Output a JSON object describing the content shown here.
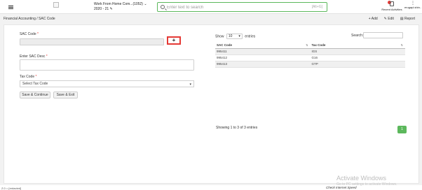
{
  "header": {
    "company_name": "Work From Home Com...(1052)",
    "company_year": "2020 - 21",
    "search_placeholder": "Enter text to search",
    "search_shortcut": "[Alt+G]",
    "recent_label": "Recent Activities",
    "user_label": "erugapl.shin.."
  },
  "breadcrumb": "Financial Accounting / SAC Code",
  "actions": {
    "add": "Add",
    "edit": "Edit",
    "report": "Report"
  },
  "form": {
    "sac_label": "SAC Code",
    "sac_value": "",
    "plus_label": "+",
    "desc_label": "Enter SAC Desc",
    "tax_label": "Tax Code",
    "tax_selected": "Select Tax Code",
    "save_continue": "Save & Continue",
    "save_exit": "Save & Exit",
    "required_mark": "*"
  },
  "table": {
    "show_label": "Show",
    "show_value": "10",
    "entries_label": "entries",
    "search_label": "Search:",
    "columns": [
      "SAC Code",
      "Tax Code"
    ],
    "rows": [
      [
        "995411",
        "IGS"
      ],
      [
        "995412",
        "G16"
      ],
      [
        "995413",
        "GTP"
      ]
    ],
    "info": "Showing 1 to 3 of 3 entries",
    "page": "1"
  },
  "watermark": {
    "title": "Activate Windows",
    "subtitle": "Go to PC settings to activate Windows."
  },
  "footer": {
    "status": "Check Internet Speed",
    "left": "Z.0 = [redacted]"
  },
  "colors": {
    "accent": "#5cb85c",
    "highlight": "#e53935"
  }
}
